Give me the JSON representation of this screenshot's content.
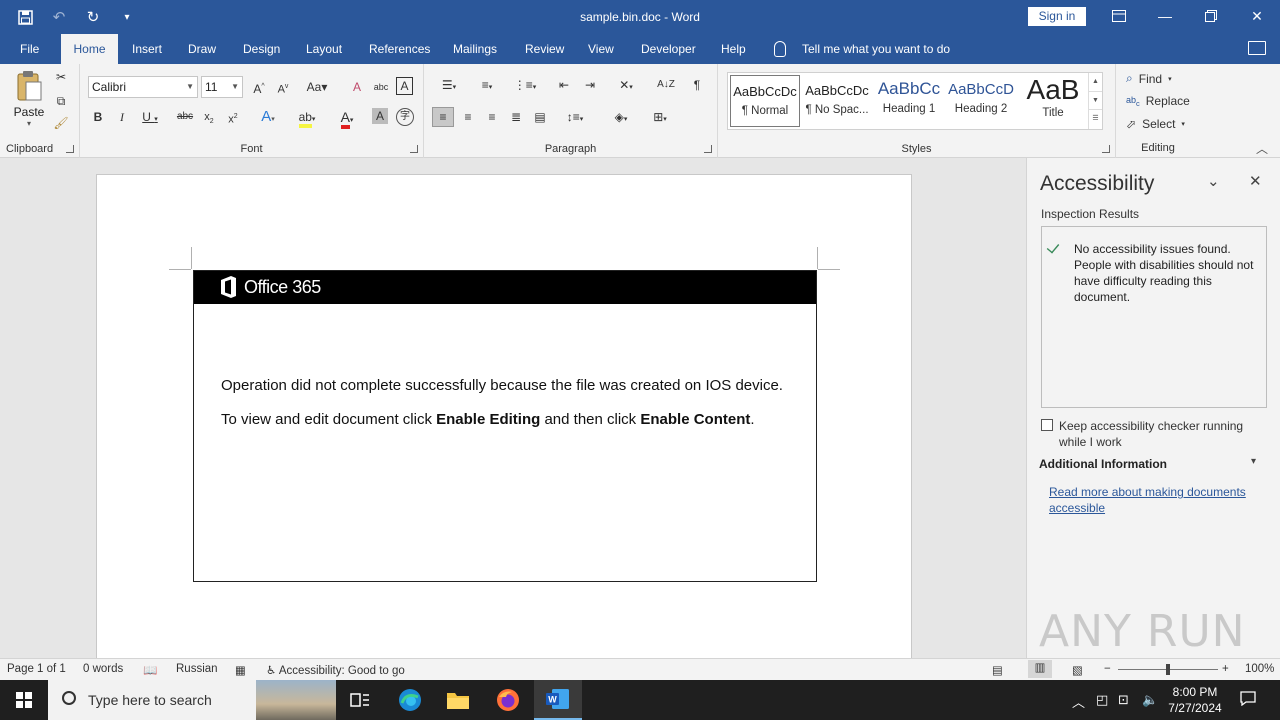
{
  "app": {
    "document_title": "sample.bin.doc - Word",
    "sign_in": "Sign in"
  },
  "tabs": [
    "File",
    "Home",
    "Insert",
    "Draw",
    "Design",
    "Layout",
    "References",
    "Mailings",
    "Review",
    "View",
    "Developer",
    "Help"
  ],
  "active_tab": "Home",
  "tell_me": "Tell me what you want to do",
  "ribbon": {
    "clipboard": {
      "paste": "Paste",
      "label": "Clipboard"
    },
    "font": {
      "name": "Calibri",
      "size": "11",
      "label": "Font"
    },
    "paragraph": {
      "label": "Paragraph"
    },
    "styles": {
      "label": "Styles",
      "items": [
        {
          "preview": "AaBbCcDc",
          "name": "¶ Normal"
        },
        {
          "preview": "AaBbCcDc",
          "name": "¶ No Spac..."
        },
        {
          "preview": "AaBbCc",
          "name": "Heading 1"
        },
        {
          "preview": "AaBbCcD",
          "name": "Heading 2"
        },
        {
          "preview": "AaB",
          "name": "Title"
        }
      ]
    },
    "editing": {
      "find": "Find",
      "replace": "Replace",
      "select": "Select",
      "label": "Editing"
    }
  },
  "document": {
    "banner": "Office 365",
    "line1": "Operation did not complete successfully because the file was created on IOS device.",
    "line2_pre": "To view and edit document click ",
    "line2_b1": "Enable Editing",
    "line2_mid": " and then click ",
    "line2_b2": "Enable Content",
    "line2_end": "."
  },
  "pane": {
    "title": "Accessibility",
    "subtitle": "Inspection Results",
    "result": "No accessibility issues found. People with disabilities should not have difficulty reading this document.",
    "keep_running": "Keep accessibility checker running while I work",
    "additional": "Additional Information",
    "read_more": "Read more about making documents accessible",
    "watermark": "ANY RUN"
  },
  "status": {
    "page": "Page 1 of 1",
    "words": "0 words",
    "language": "Russian",
    "accessibility": "Accessibility: Good to go",
    "zoom": "100%"
  },
  "taskbar": {
    "search_placeholder": "Type here to search",
    "time": "8:00 PM",
    "date": "7/27/2024"
  },
  "colors": {
    "word_blue": "#2b579a",
    "ribbon_bg": "#f3f3f3",
    "taskbar": "#1f1f1f"
  }
}
